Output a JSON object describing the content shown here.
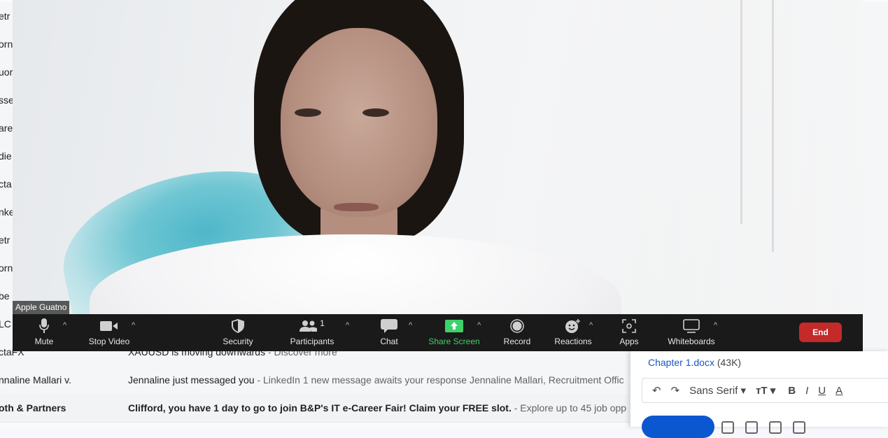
{
  "gmail": {
    "rows_top": [
      {
        "sender": "etr"
      },
      {
        "sender": "orn"
      },
      {
        "sender": "uor"
      },
      {
        "sender": "sse"
      },
      {
        "sender": "are"
      },
      {
        "sender": "die"
      },
      {
        "sender": "cta"
      },
      {
        "sender": "nke"
      },
      {
        "sender": "etr"
      },
      {
        "sender": "orn"
      },
      {
        "sender": "be"
      },
      {
        "sender": "LC"
      }
    ],
    "rows_visible": [
      {
        "sender": "ctaFX",
        "subject": "XAUUSD is moving downwards",
        "snippet": " - Discover more",
        "unread": false
      },
      {
        "sender": "nnaline Mallari v.",
        "subject": "Jennaline just messaged you",
        "snippet": " - LinkedIn 1 new message awaits your response Jennaline Mallari, Recruitment Offic",
        "unread": false
      },
      {
        "sender": "oth & Partners",
        "subject": "Clifford, you have 1 day to go to join B&P's IT e-Career Fair! Claim your FREE slot.",
        "snippet": " - Explore up to 45 job opp",
        "unread": true
      }
    ]
  },
  "zoom": {
    "participant_name": "Apple Guatno",
    "participants_count": "1",
    "toolbar": {
      "mute": "Mute",
      "stop_video": "Stop Video",
      "security": "Security",
      "participants": "Participants",
      "chat": "Chat",
      "share_screen": "Share Screen",
      "record": "Record",
      "reactions": "Reactions",
      "apps": "Apps",
      "whiteboards": "Whiteboards",
      "end": "End"
    },
    "colors": {
      "share_green": "#3fd16b",
      "end_red": "#c42a2a"
    }
  },
  "compose": {
    "attachment_name": "Chapter 1.docx",
    "attachment_size": "(43K)",
    "font": "Sans Serif",
    "bold": "B",
    "italic": "I",
    "underline": "U",
    "text_color": "A"
  }
}
